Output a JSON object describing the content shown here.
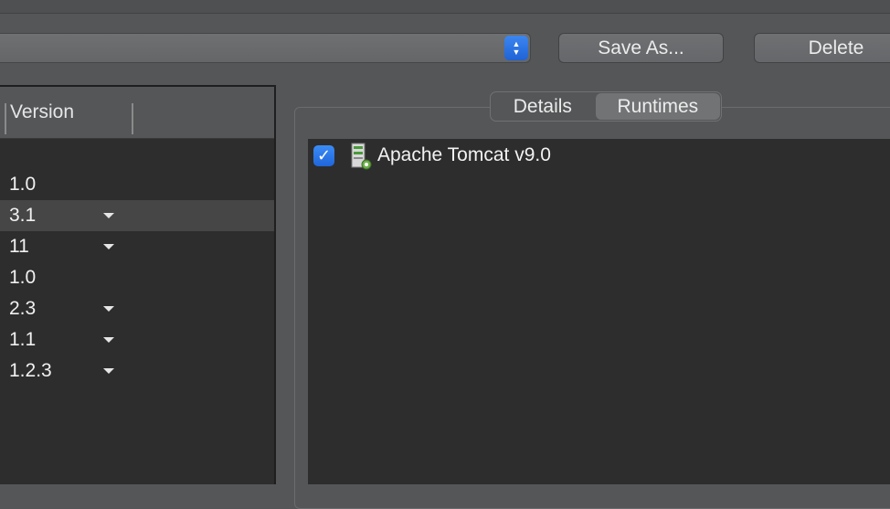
{
  "toolbar": {
    "save_as_label": "Save As...",
    "delete_label": "Delete"
  },
  "table": {
    "column_version": "Version",
    "rows": [
      {
        "version": "1.0",
        "has_dropdown": false,
        "selected": false
      },
      {
        "version": "3.1",
        "has_dropdown": true,
        "selected": true
      },
      {
        "version": "11",
        "has_dropdown": true,
        "selected": false
      },
      {
        "version": "1.0",
        "has_dropdown": false,
        "selected": false
      },
      {
        "version": "2.3",
        "has_dropdown": true,
        "selected": false
      },
      {
        "version": "1.1",
        "has_dropdown": true,
        "selected": false
      },
      {
        "version": "1.2.3",
        "has_dropdown": true,
        "selected": false
      }
    ]
  },
  "tabs": {
    "details": "Details",
    "runtimes": "Runtimes",
    "active": "runtimes"
  },
  "runtimes": {
    "items": [
      {
        "label": "Apache Tomcat v9.0",
        "checked": true,
        "icon": "server-icon"
      }
    ]
  },
  "colors": {
    "accent": "#2a74e6",
    "panel_bg": "#2d2d2d",
    "window_bg": "#545658"
  }
}
